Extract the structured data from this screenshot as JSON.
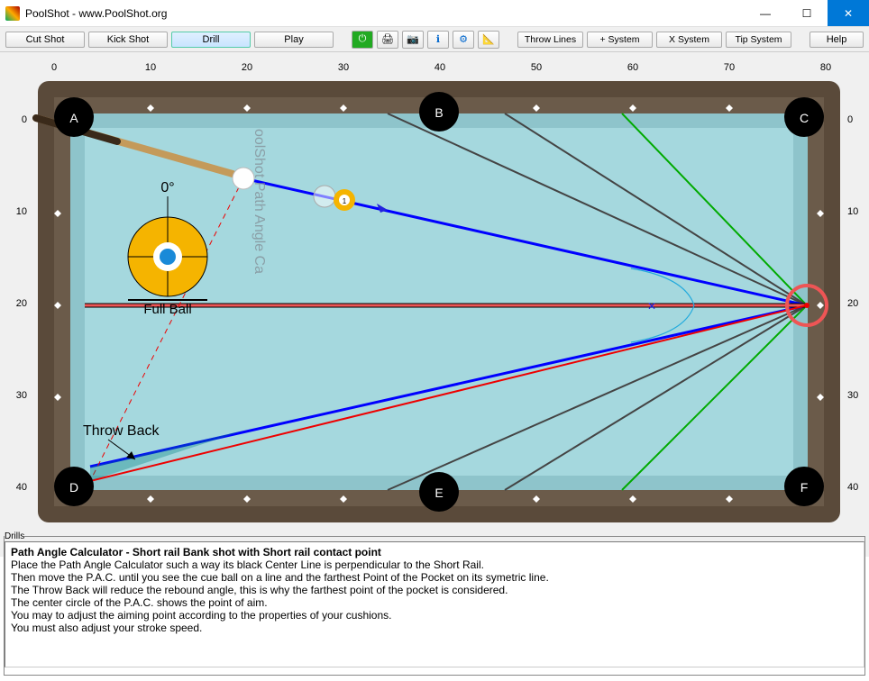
{
  "window": {
    "title": "PoolShot - www.PoolShot.org"
  },
  "toolbar": {
    "cut_shot": "Cut Shot",
    "kick_shot": "Kick Shot",
    "drill": "Drill",
    "play": "Play",
    "throw_lines": "Throw Lines",
    "plus_system": "+ System",
    "x_system": "X System",
    "tip_system": "Tip System",
    "help": "Help"
  },
  "aim": {
    "angle": "0°",
    "hit": "Full Ball"
  },
  "annotations": {
    "throw_back": "Throw Back",
    "watermark": "oolShot Path Angle Ca"
  },
  "pockets": {
    "a": "A",
    "b": "B",
    "c": "C",
    "d": "D",
    "e": "E",
    "f": "F"
  },
  "ruler": {
    "x": [
      "0",
      "10",
      "20",
      "30",
      "40",
      "50",
      "60",
      "70",
      "80"
    ],
    "y": [
      "0",
      "10",
      "20",
      "30",
      "40"
    ]
  },
  "drills": {
    "legend": "Drills",
    "title": "Path Angle Calculator - Short rail Bank shot with Short rail contact point",
    "lines": [
      "Place the Path Angle Calculator such a way its black Center Line is perpendicular to the Short Rail.",
      "Then move the P.A.C. until you see the cue ball on a line and the farthest Point of the Pocket on its symetric line.",
      "The Throw Back will reduce the rebound angle, this is why the farthest point of the pocket is considered.",
      "The center circle of the P.A.C. shows the point of aim.",
      "You may to adjust the aiming point according to the properties of your cushions.",
      "You must also adjust your stroke speed."
    ]
  }
}
